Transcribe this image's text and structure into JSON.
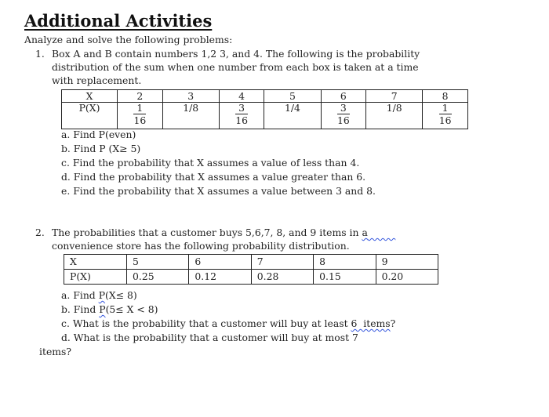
{
  "title": "Additional Activities",
  "intro": "Analyze and solve the following problems:",
  "problem1": {
    "number": "1.",
    "lines": [
      "Box A and B contain numbers 1,2 3, and 4. The following is the probability",
      "distribution of the sum when one number from each box is taken at a time",
      "with replacement."
    ],
    "table": {
      "x_label": "X",
      "p_label": "P(X)",
      "x_values": [
        "2",
        "3",
        "4",
        "5",
        "6",
        "7",
        "8"
      ],
      "p_values": [
        {
          "type": "frac",
          "num": "1",
          "den": "16"
        },
        {
          "type": "text",
          "text": "1/8"
        },
        {
          "type": "frac",
          "num": "3",
          "den": "16"
        },
        {
          "type": "text",
          "text": "1/4"
        },
        {
          "type": "frac",
          "num": "3",
          "den": "16"
        },
        {
          "type": "text",
          "text": "1/8"
        },
        {
          "type": "frac",
          "num": "1",
          "den": "16"
        }
      ]
    },
    "questions": [
      "a. Find P(even)",
      "b. Find P (X≥ 5)",
      "c. Find the probability that X assumes a value of less than 4.",
      "d. Find the probability that X assumes a value greater than 6.",
      "e. Find the probability that X assumes a value between 3 and 8."
    ]
  },
  "problem2": {
    "number": "2.",
    "line1_main": "The probabilities that a customer buys 5,6,7, 8, and 9 items in ",
    "line1_flagged": "a",
    "line1_trailing_spaces": "         ",
    "line2": "convenience store has the following probability distribution.",
    "table": {
      "x_label": "X",
      "p_label": "P(X)",
      "x_values": [
        "5",
        "6",
        "7",
        "8",
        "9"
      ],
      "p_values": [
        "0.25",
        "0.12",
        "0.28",
        "0.15",
        "0.20"
      ]
    },
    "questions": {
      "a": {
        "prefix": "a. Find ",
        "flagged": "P",
        "suffix": "(X≤ 8)"
      },
      "b": {
        "prefix": "b. Find ",
        "flagged": "P",
        "suffix": "(5≤ X < 8)"
      },
      "c": {
        "prefix": "c. What is the probability that a customer will buy at least ",
        "flagged": "6  items",
        "suffix": "?"
      },
      "d": {
        "text": "d. What is the probability that a customer will buy at most 7"
      },
      "d_wrap": "items?"
    }
  }
}
